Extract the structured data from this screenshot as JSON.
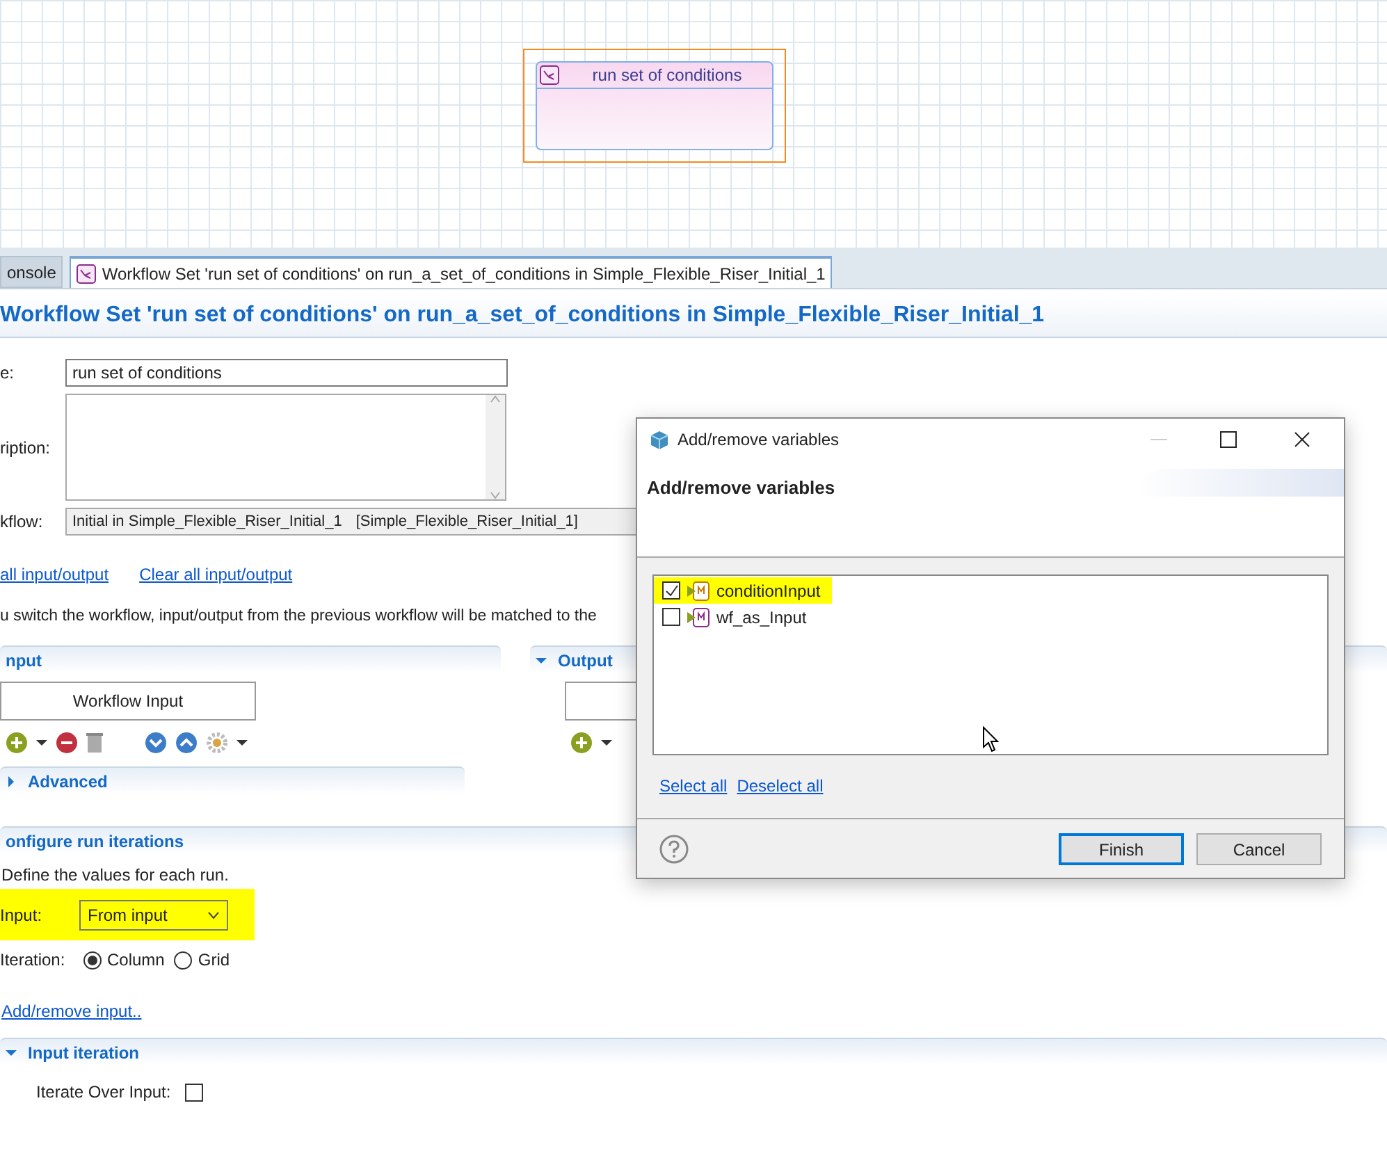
{
  "diagram": {
    "node": {
      "title": "run set of conditions",
      "selected": true
    }
  },
  "tabs": [
    {
      "label": "onsole",
      "selected": false
    },
    {
      "label": "Workflow Set 'run set of conditions' on run_a_set_of_conditions in Simple_Flexible_Riser_Initial_1",
      "selected": true
    }
  ],
  "editor": {
    "title": "Workflow Set 'run set of conditions' on run_a_set_of_conditions in Simple_Flexible_Riser_Initial_1",
    "fields": [
      {
        "kind": "text",
        "label": "e:",
        "value": "run set of conditions"
      },
      {
        "kind": "textarea",
        "label": "ription:"
      },
      {
        "kind": "readonly",
        "label": "kflow:",
        "value": "Initial in Simple_Flexible_Riser_Initial_1",
        "value_2": "[Simple_Flexible_Riser_Initial_1]"
      }
    ],
    "links": [
      "all input/output",
      "Clear all input/output"
    ],
    "note": "u switch the workflow, input/output from the previous workflow will be matched to the",
    "input_section": {
      "title": "nput",
      "button": "Workflow Input",
      "advanced": {
        "title": "Advanced",
        "expanded": false
      }
    },
    "output_section": {
      "title": "Output",
      "expanded": true
    },
    "iterations": {
      "title": "onfigure run iterations",
      "description": "Define the values for each run.",
      "input": {
        "label": "Input:",
        "value": "From input",
        "highlighted": true
      },
      "iteration": {
        "label": "Iteration:",
        "options": [
          {
            "label": "Column",
            "selected": true
          },
          {
            "label": "Grid",
            "selected": false
          }
        ]
      },
      "link": "Add/remove input..",
      "input_iteration": {
        "title": "Input iteration",
        "expanded": true,
        "checkbox": {
          "label": "Iterate Over Input:",
          "checked": false
        }
      }
    }
  },
  "dialog": {
    "title": "Add/remove variables",
    "heading": "Add/remove variables",
    "variables": [
      {
        "name": "conditionInput",
        "checked": true,
        "highlighted": true
      },
      {
        "name": "wf_as_Input",
        "checked": false,
        "highlighted": false
      }
    ],
    "links": [
      "Select all",
      "Deselect all"
    ],
    "buttons": [
      {
        "label": "Finish",
        "default": true
      },
      {
        "label": "Cancel",
        "default": false
      }
    ]
  }
}
